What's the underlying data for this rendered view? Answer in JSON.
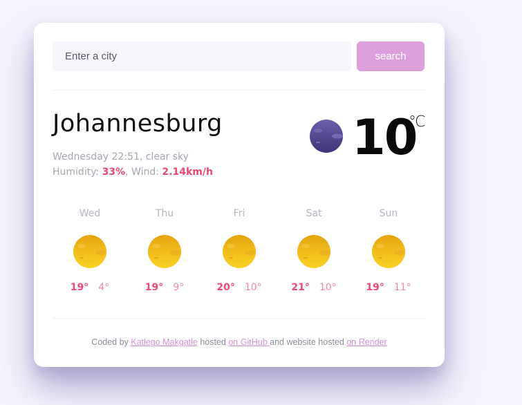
{
  "search": {
    "placeholder": "Enter a city",
    "button_label": "search"
  },
  "current": {
    "city": "Johannesburg",
    "day_time": "Wednesday 22:51",
    "separator": ", ",
    "description": "clear sky",
    "humidity_label": "Humidity: ",
    "humidity_value": "33%",
    "wind_label": ", Wind: ",
    "wind_value": "2.14km/h",
    "temperature": "10",
    "unit": "℃",
    "icon": "clear-night-moon-icon"
  },
  "forecast": [
    {
      "day": "Wed",
      "max": "19°",
      "min": "4°",
      "icon": "sun-icon"
    },
    {
      "day": "Thu",
      "max": "19°",
      "min": "9°",
      "icon": "sun-icon"
    },
    {
      "day": "Fri",
      "max": "20°",
      "min": "10°",
      "icon": "sun-icon"
    },
    {
      "day": "Sat",
      "max": "21°",
      "min": "10°",
      "icon": "sun-icon"
    },
    {
      "day": "Sun",
      "max": "19°",
      "min": "11°",
      "icon": "sun-icon"
    }
  ],
  "footer": {
    "coded_by": "Coded by ",
    "author": "Katlego Makgatle",
    "hosted": " hosted ",
    "github_link": "on GitHub ",
    "website_hosted": "and website hosted ",
    "render_link": "on Render"
  },
  "colors": {
    "accent": "#ef476f",
    "button": "#dda0dd",
    "link": "#d78fd7",
    "sun": "#f5b914",
    "moon": "#5a4f9e"
  }
}
